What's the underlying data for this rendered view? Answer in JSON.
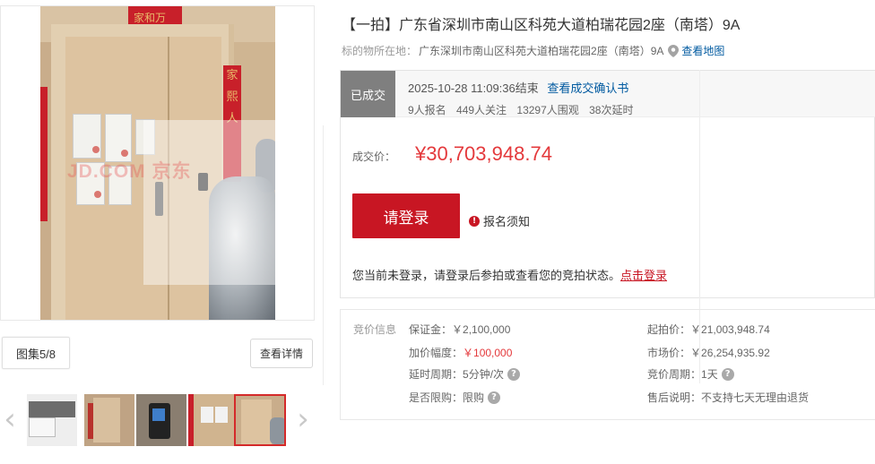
{
  "gallery": {
    "album_label": "图集5/8",
    "detail_button": "查看详情",
    "watermark": "JD.COM 京东",
    "banner_top_text": "家和万",
    "banner_right_text": "家熙人"
  },
  "item": {
    "title": "【一拍】广东省深圳市南山区科苑大道柏瑞花园2座（南塔）9A",
    "location_label": "标的物所在地：",
    "location_value": "广东深圳市南山区科苑大道柏瑞花园2座（南塔）9A",
    "map_link": "查看地图"
  },
  "status": {
    "tag": "已成交",
    "end_time": "2025-10-28 11:09:36结束",
    "confirm_link": "查看成交确认书",
    "signups": "9人报名",
    "followers": "449人关注",
    "viewers": "13297人围观",
    "extensions": "38次延时",
    "price_label": "成交价：",
    "price_value": "¥30,703,948.74",
    "login_button": "请登录",
    "notice": "报名须知",
    "login_tip": "您当前未登录，请登录后参拍或查看您的竞拍状态。",
    "login_link": "点击登录"
  },
  "bid": {
    "title": "竞价信息",
    "deposit": {
      "label": "保证金：",
      "value": "￥2,100,000"
    },
    "start_price": {
      "label": "起拍价：",
      "value": "￥21,003,948.74"
    },
    "increment": {
      "label": "加价幅度：",
      "value": "￥100,000"
    },
    "market_price": {
      "label": "市场价：",
      "value": "￥26,254,935.92"
    },
    "delay_period": {
      "label": "延时周期：",
      "value": "5分钟/次"
    },
    "bid_period": {
      "label": "竞价周期：",
      "value": "1天"
    },
    "purchase_limit": {
      "label": "是否限购：",
      "value": "限购"
    },
    "after_sale": {
      "label": "售后说明：",
      "value": "不支持七天无理由退货"
    }
  },
  "colors": {
    "brand_red": "#c81623",
    "price_red": "#e4393c",
    "link_blue": "#005aa0",
    "tag_gray": "#7f7f7f"
  }
}
